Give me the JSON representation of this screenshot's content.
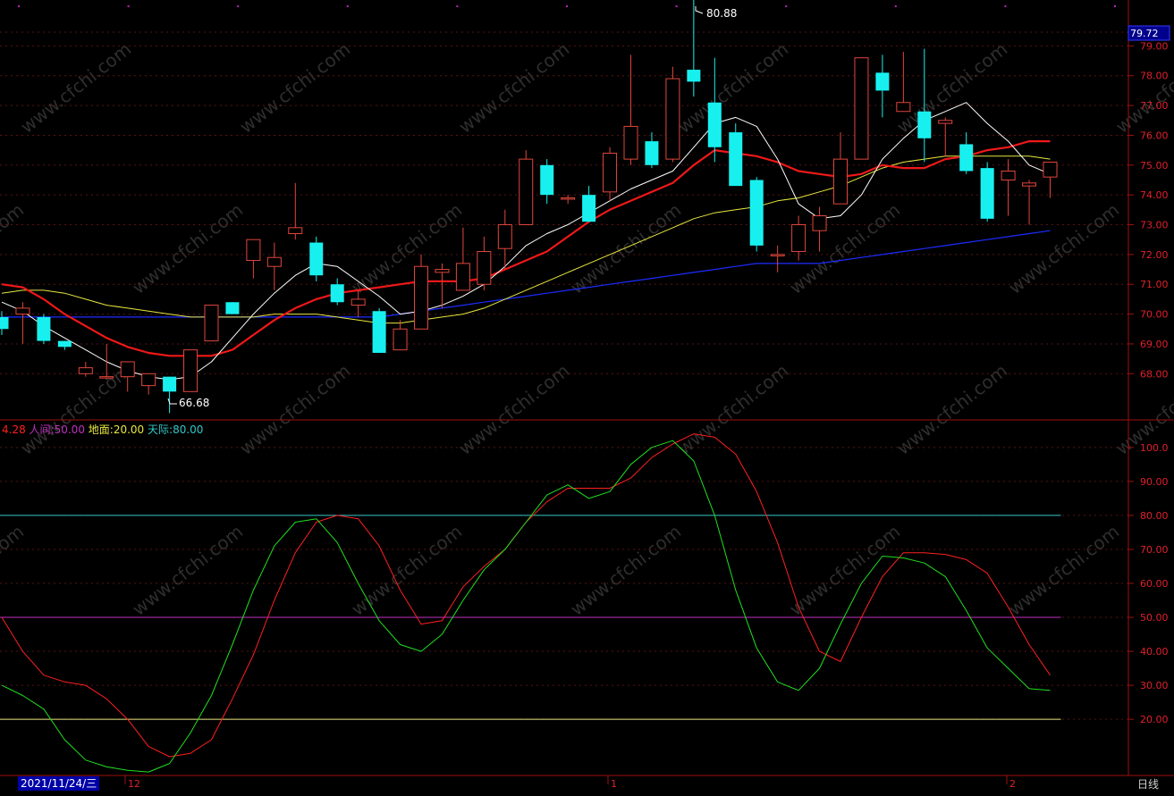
{
  "colors": {
    "background": "#000000",
    "frame": "#a01010",
    "grid": "#5a1414",
    "axis_text": "#e0202c",
    "up_candle": "#e0463c",
    "down_candle": "#18f0f0",
    "ma5": "#ffffff",
    "ma10": "#f01818",
    "ma20": "#e8e840",
    "ma60": "#1c2cff",
    "k_line": "#ff2020",
    "d_line": "#20e020",
    "tian_line": "#30c8c8",
    "ren_line": "#c030c0",
    "di_line": "#e8e880",
    "watermark": "#2e2e2e"
  },
  "price_axis": {
    "current_price": "79.72",
    "ticks": [
      "79.00",
      "78.00",
      "77.00",
      "76.00",
      "75.00",
      "74.00",
      "73.00",
      "72.00",
      "71.00",
      "70.00",
      "69.00",
      "68.00"
    ]
  },
  "indicator_axis": {
    "ticks": [
      "100.0",
      "90.00",
      "80.00",
      "70.00",
      "60.00",
      "50.00",
      "40.00",
      "30.00",
      "20.00"
    ]
  },
  "indicator_legend": {
    "value_fragment": "4.28",
    "ren_label": "人间:",
    "ren_value": "50.00",
    "di_label": "地面:",
    "di_value": "20.00",
    "tian_label": "天际:",
    "tian_value": "80.00"
  },
  "annotations": {
    "high_label": "80.88",
    "low_label": "66.68"
  },
  "bottom_bar": {
    "cursor_date": "2021/11/24/三",
    "month_ticks": [
      "12",
      "1",
      "2"
    ],
    "period": "日线"
  },
  "watermark_text": "www.cfchi.com",
  "chart_data": [
    {
      "type": "candlestick",
      "ylim": [
        66.9,
        80.3
      ],
      "grid": true,
      "candles": [
        {
          "o": 69.9,
          "h": 70.1,
          "l": 69.3,
          "c": 69.5
        },
        {
          "o": 70.0,
          "h": 70.4,
          "l": 69.0,
          "c": 70.2
        },
        {
          "o": 69.9,
          "h": 70.0,
          "l": 69.0,
          "c": 69.1
        },
        {
          "o": 69.1,
          "h": 69.1,
          "l": 68.8,
          "c": 68.9
        },
        {
          "o": 68.0,
          "h": 68.4,
          "l": 67.9,
          "c": 68.2
        },
        {
          "o": 67.9,
          "h": 69.0,
          "l": 67.8,
          "c": 67.9
        },
        {
          "o": 67.9,
          "h": 68.3,
          "l": 67.4,
          "c": 68.4
        },
        {
          "o": 67.6,
          "h": 68.0,
          "l": 67.3,
          "c": 68.0
        },
        {
          "o": 67.9,
          "h": 67.9,
          "l": 66.68,
          "c": 67.4
        },
        {
          "o": 67.4,
          "h": 68.8,
          "l": 67.4,
          "c": 68.8
        },
        {
          "o": 69.1,
          "h": 70.3,
          "l": 69.1,
          "c": 70.3
        },
        {
          "o": 70.4,
          "h": 70.4,
          "l": 70.0,
          "c": 70.0
        },
        {
          "o": 71.8,
          "h": 72.2,
          "l": 71.2,
          "c": 72.5
        },
        {
          "o": 71.6,
          "h": 72.4,
          "l": 70.8,
          "c": 71.9
        },
        {
          "o": 72.7,
          "h": 74.4,
          "l": 72.5,
          "c": 72.9
        },
        {
          "o": 72.4,
          "h": 72.6,
          "l": 71.1,
          "c": 71.3
        },
        {
          "o": 71.0,
          "h": 71.2,
          "l": 70.3,
          "c": 70.4
        },
        {
          "o": 70.3,
          "h": 70.8,
          "l": 69.9,
          "c": 70.5
        },
        {
          "o": 70.1,
          "h": 70.2,
          "l": 68.7,
          "c": 68.7
        },
        {
          "o": 68.8,
          "h": 69.8,
          "l": 68.8,
          "c": 69.5
        },
        {
          "o": 69.5,
          "h": 72.0,
          "l": 69.5,
          "c": 71.6
        },
        {
          "o": 71.4,
          "h": 71.7,
          "l": 70.2,
          "c": 71.5
        },
        {
          "o": 70.8,
          "h": 72.9,
          "l": 70.8,
          "c": 71.7
        },
        {
          "o": 71.0,
          "h": 72.6,
          "l": 70.8,
          "c": 72.1
        },
        {
          "o": 72.2,
          "h": 73.5,
          "l": 71.5,
          "c": 73.0
        },
        {
          "o": 73.0,
          "h": 75.5,
          "l": 73.0,
          "c": 75.2
        },
        {
          "o": 75.0,
          "h": 75.2,
          "l": 73.7,
          "c": 74.0
        },
        {
          "o": 73.9,
          "h": 74.0,
          "l": 73.7,
          "c": 73.9
        },
        {
          "o": 74.0,
          "h": 74.3,
          "l": 73.1,
          "c": 73.1
        },
        {
          "o": 74.1,
          "h": 75.6,
          "l": 73.8,
          "c": 75.4
        },
        {
          "o": 75.2,
          "h": 78.7,
          "l": 75.0,
          "c": 76.3
        },
        {
          "o": 75.8,
          "h": 76.1,
          "l": 74.9,
          "c": 75.0
        },
        {
          "o": 75.2,
          "h": 78.3,
          "l": 75.1,
          "c": 77.9
        },
        {
          "o": 78.2,
          "h": 80.88,
          "l": 77.3,
          "c": 77.8
        },
        {
          "o": 77.1,
          "h": 78.6,
          "l": 75.1,
          "c": 75.6
        },
        {
          "o": 76.1,
          "h": 76.4,
          "l": 74.6,
          "c": 74.3
        },
        {
          "o": 74.5,
          "h": 74.6,
          "l": 72.1,
          "c": 72.3
        },
        {
          "o": 72.0,
          "h": 72.3,
          "l": 71.4,
          "c": 72.0
        },
        {
          "o": 72.1,
          "h": 73.3,
          "l": 71.8,
          "c": 73.0
        },
        {
          "o": 72.8,
          "h": 73.6,
          "l": 72.1,
          "c": 73.3
        },
        {
          "o": 73.7,
          "h": 76.1,
          "l": 73.7,
          "c": 75.2
        },
        {
          "o": 75.2,
          "h": 78.6,
          "l": 75.2,
          "c": 78.6
        },
        {
          "o": 78.1,
          "h": 78.7,
          "l": 76.6,
          "c": 77.5
        },
        {
          "o": 76.8,
          "h": 78.8,
          "l": 76.8,
          "c": 77.1
        },
        {
          "o": 76.8,
          "h": 78.9,
          "l": 75.1,
          "c": 75.9
        },
        {
          "o": 76.4,
          "h": 76.6,
          "l": 75.3,
          "c": 76.5
        },
        {
          "o": 75.7,
          "h": 76.1,
          "l": 74.7,
          "c": 74.8
        },
        {
          "o": 74.9,
          "h": 75.1,
          "l": 73.1,
          "c": 73.2
        },
        {
          "o": 74.5,
          "h": 75.2,
          "l": 73.3,
          "c": 74.8
        },
        {
          "o": 74.3,
          "h": 74.5,
          "l": 73.0,
          "c": 74.4
        },
        {
          "o": 74.6,
          "h": 75.1,
          "l": 73.9,
          "c": 75.1
        }
      ],
      "ma5": [
        70.4,
        70.1,
        69.6,
        69.2,
        68.8,
        68.4,
        68.1,
        67.9,
        67.8,
        67.9,
        68.4,
        69.2,
        70.0,
        70.7,
        71.3,
        71.7,
        71.6,
        71.1,
        70.6,
        70.0,
        70.1,
        70.3,
        70.6,
        71.0,
        71.6,
        72.3,
        72.7,
        73.0,
        73.4,
        73.8,
        74.2,
        74.5,
        74.8,
        75.6,
        76.4,
        76.6,
        76.3,
        75.2,
        73.7,
        73.2,
        73.3,
        74.0,
        75.2,
        75.9,
        76.5,
        76.8,
        77.1,
        76.4,
        75.8,
        75.0,
        74.7
      ],
      "ma10": [
        71.0,
        70.9,
        70.5,
        70.0,
        69.6,
        69.2,
        68.9,
        68.7,
        68.6,
        68.6,
        68.6,
        68.8,
        69.3,
        69.8,
        70.2,
        70.5,
        70.7,
        70.8,
        70.9,
        71.0,
        71.1,
        71.1,
        71.1,
        71.2,
        71.5,
        71.8,
        72.1,
        72.6,
        73.1,
        73.5,
        73.8,
        74.1,
        74.4,
        75.0,
        75.5,
        75.4,
        75.3,
        75.1,
        74.8,
        74.7,
        74.6,
        74.7,
        75.0,
        74.9,
        74.9,
        75.2,
        75.3,
        75.5,
        75.6,
        75.8,
        75.8
      ],
      "ma20": [
        70.7,
        70.8,
        70.8,
        70.7,
        70.5,
        70.3,
        70.2,
        70.1,
        70.0,
        69.9,
        69.9,
        69.9,
        69.9,
        70.0,
        70.0,
        70.0,
        69.9,
        69.8,
        69.7,
        69.7,
        69.8,
        69.9,
        70.0,
        70.2,
        70.5,
        70.8,
        71.1,
        71.4,
        71.7,
        72.0,
        72.3,
        72.6,
        72.9,
        73.2,
        73.4,
        73.5,
        73.6,
        73.8,
        73.9,
        74.1,
        74.3,
        74.6,
        74.9,
        75.1,
        75.2,
        75.3,
        75.3,
        75.3,
        75.3,
        75.3,
        75.2
      ],
      "ma60": [
        69.9,
        69.9,
        69.9,
        69.9,
        69.9,
        69.9,
        69.9,
        69.9,
        69.9,
        69.9,
        69.9,
        69.9,
        69.9,
        69.9,
        69.9,
        69.9,
        69.9,
        69.9,
        69.9,
        70.0,
        70.1,
        70.2,
        70.3,
        70.4,
        70.5,
        70.6,
        70.7,
        70.8,
        70.9,
        71.0,
        71.1,
        71.2,
        71.3,
        71.4,
        71.5,
        71.6,
        71.7,
        71.7,
        71.7,
        71.7,
        71.8,
        71.9,
        72.0,
        72.1,
        72.2,
        72.3,
        72.4,
        72.5,
        72.6,
        72.7,
        72.8
      ]
    },
    {
      "type": "line",
      "ylim": [
        4,
        106
      ],
      "grid": true,
      "hlines": {
        "tian": 80,
        "ren": 50,
        "di": 20
      },
      "k": [
        50.0,
        40.0,
        33.0,
        31.0,
        30.0,
        26.0,
        20.0,
        12.0,
        9.0,
        10.0,
        14.0,
        26.0,
        39.0,
        55.0,
        69.0,
        78.0,
        80.0,
        79.0,
        71.0,
        58.0,
        48.0,
        49.0,
        59.0,
        65.0,
        70.0,
        78.0,
        84.0,
        88.0,
        88.0,
        88.0,
        91.0,
        97.0,
        101.0,
        104.0,
        103.0,
        98.0,
        87.0,
        72.0,
        53.0,
        40.0,
        37.0,
        50.0,
        62.0,
        69.0,
        69.0,
        68.5,
        67.0,
        63.0,
        53.0,
        42.0,
        33.0
      ],
      "d": [
        30.0,
        27.0,
        23.0,
        14.0,
        8.0,
        6.0,
        5.0,
        4.5,
        7.0,
        16.0,
        27.0,
        42.0,
        58.0,
        71.0,
        78.0,
        79.0,
        72.0,
        60.0,
        49.0,
        42.0,
        40.0,
        45.0,
        55.0,
        64.0,
        70.0,
        78.0,
        86.0,
        89.0,
        85.0,
        87.0,
        95.0,
        100.0,
        102.0,
        96.0,
        80.0,
        58.0,
        41.0,
        31.0,
        28.5,
        35.0,
        48.0,
        60.0,
        68.0,
        67.5,
        66.0,
        62.0,
        52.0,
        41.0,
        35.0,
        29.0,
        28.5
      ]
    }
  ]
}
